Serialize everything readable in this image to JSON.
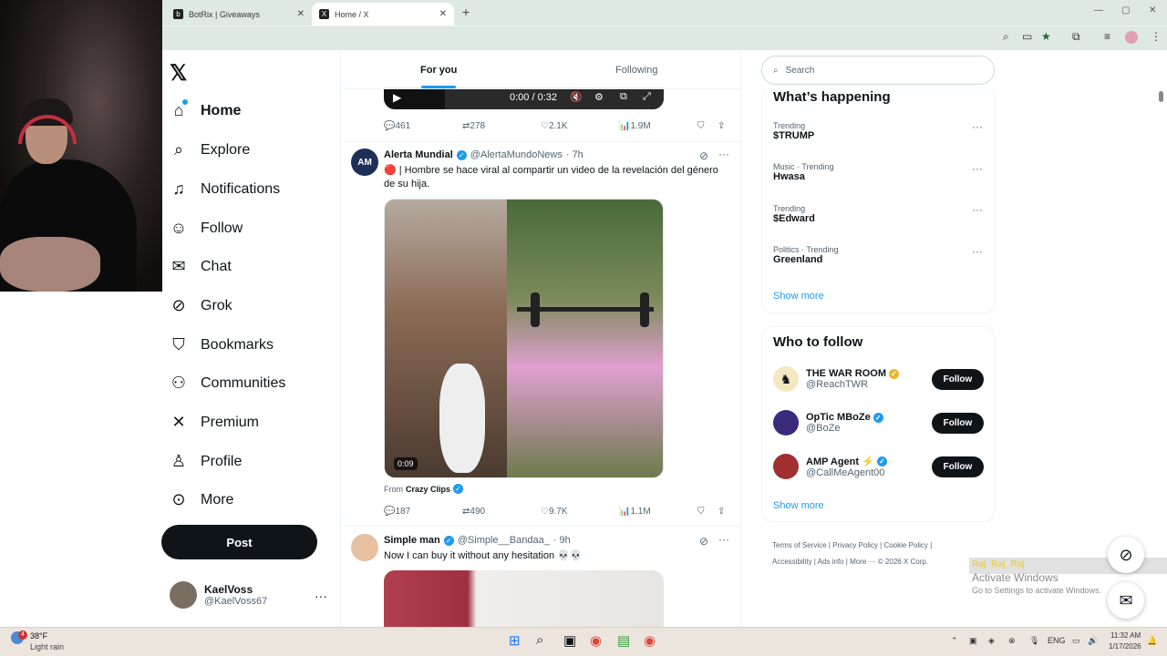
{
  "browser": {
    "tabs": [
      {
        "title": "BotRix | Giveaways",
        "active": false
      },
      {
        "title": "Home / X",
        "active": true
      }
    ],
    "new_tab": "+",
    "window_controls": [
      "—",
      "▢",
      "✕"
    ]
  },
  "nav": {
    "logo": "𝕏",
    "items": [
      {
        "label": "Home",
        "icon": "home-icon"
      },
      {
        "label": "Explore",
        "icon": "search-icon"
      },
      {
        "label": "Notifications",
        "icon": "bell-icon"
      },
      {
        "label": "Follow",
        "icon": "person-add-icon"
      },
      {
        "label": "Chat",
        "icon": "mail-icon"
      },
      {
        "label": "Grok",
        "icon": "grok-icon"
      },
      {
        "label": "Bookmarks",
        "icon": "bookmark-icon"
      },
      {
        "label": "Communities",
        "icon": "people-icon"
      },
      {
        "label": "Premium",
        "icon": "x-icon"
      },
      {
        "label": "Profile",
        "icon": "person-icon"
      },
      {
        "label": "More",
        "icon": "more-circle-icon"
      }
    ],
    "post_label": "Post",
    "account": {
      "name": "KaelVoss",
      "handle": "@KaelVoss67",
      "more": "···"
    }
  },
  "feed": {
    "tabs": [
      {
        "label": "For you",
        "active": true
      },
      {
        "label": "Following",
        "active": false
      }
    ],
    "top_video": {
      "time": "0:00 / 0:32"
    },
    "top_actions": {
      "replies": "461",
      "reposts": "278",
      "likes": "2.1K",
      "views": "1.9M"
    },
    "tweet1": {
      "name": "Alerta Mundial",
      "handle": "@AlertaMundoNews",
      "time": "· 7h",
      "text": "🔴 | Hombre se hace viral al compartir un video de la revelación del género de su hija.",
      "duration": "0:09",
      "from_prefix": "From",
      "from_name": "Crazy Clips",
      "actions": {
        "replies": "187",
        "reposts": "490",
        "likes": "9.7K",
        "views": "1.1M"
      }
    },
    "tweet2": {
      "name": "Simple man",
      "handle": "@Simple__Bandaa_",
      "time": "· 9h",
      "text": "Now I can buy it without any hesitation 💀💀"
    }
  },
  "sidebar": {
    "search_placeholder": "Search",
    "happening_title": "What’s happening",
    "trends": [
      {
        "meta": "Trending",
        "title": "$TRUMP"
      },
      {
        "meta": "Music · Trending",
        "title": "Hwasa"
      },
      {
        "meta": "Trending",
        "title": "$Edward"
      },
      {
        "meta": "Politics · Trending",
        "title": "Greenland"
      }
    ],
    "show_more": "Show more",
    "who_title": "Who to follow",
    "who": [
      {
        "name": "THE WAR ROOM",
        "handle": "@ReachTWR",
        "badge": "gold"
      },
      {
        "name": "OpTic MBoZe",
        "handle": "@BoZe",
        "badge": "blue"
      },
      {
        "name": "AMP Agent ⚡",
        "handle": "@CallMeAgent00",
        "badge": "blue"
      }
    ],
    "follow_label": "Follow",
    "footer": [
      "Terms of Service",
      "Privacy Policy",
      "Cookie Policy",
      "Accessibility",
      "Ads info",
      "More ···",
      "© 2026 X Corp."
    ]
  },
  "overlay": {
    "activate_title": "Activate Windows",
    "activate_sub": "Go to Settings to activate Windows.",
    "stream_name": "Raj_Raj_Raj"
  },
  "taskbar": {
    "weather_temp": "38°F",
    "weather_desc": "Light rain",
    "weather_badge": "4",
    "lang": "ENG",
    "time": "11:32 AM",
    "date": "1/17/2026"
  }
}
